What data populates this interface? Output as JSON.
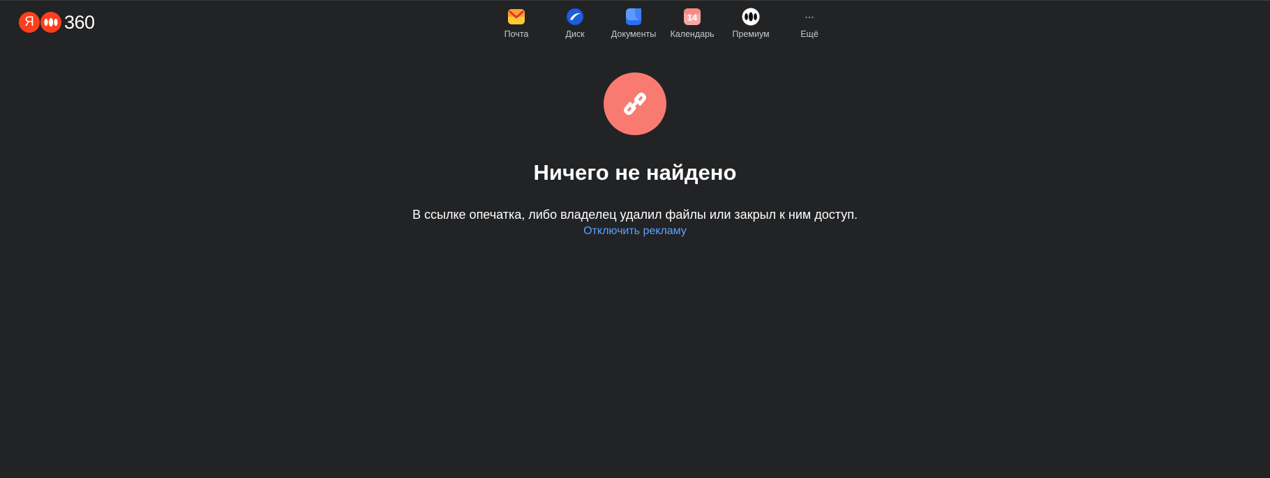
{
  "brand": {
    "ya_letter": "Я",
    "product": "360",
    "color": "#fc3f1d"
  },
  "services": [
    {
      "label": "Почта",
      "icon": "mail-icon"
    },
    {
      "label": "Диск",
      "icon": "disk-icon"
    },
    {
      "label": "Документы",
      "icon": "documents-icon"
    },
    {
      "label": "Календарь",
      "icon": "calendar-icon",
      "badge": "14"
    },
    {
      "label": "Премиум",
      "icon": "premium-icon"
    },
    {
      "label": "Ещё",
      "icon": "more-icon"
    }
  ],
  "main": {
    "icon": "broken-link-icon",
    "title": "Ничего не найдено",
    "description": "В ссылке опечатка, либо владелец удалил файлы или закрыл к ним доступ.",
    "ads_link": "Отключить рекламу"
  },
  "colors": {
    "background": "#222325",
    "error_circle": "#f97a70",
    "link": "#5ba4ff"
  }
}
